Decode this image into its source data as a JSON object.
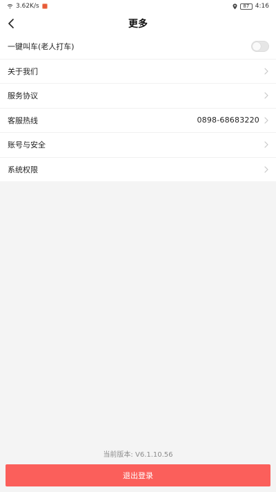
{
  "status_bar": {
    "network_speed": "3.62K/s",
    "time": "4:16",
    "battery": "87"
  },
  "header": {
    "title": "更多"
  },
  "menu": {
    "items": [
      {
        "label": "一键叫车(老人打车)",
        "type": "toggle",
        "enabled": false
      },
      {
        "label": "关于我们",
        "type": "link"
      },
      {
        "label": "服务协议",
        "type": "link"
      },
      {
        "label": "客服热线",
        "type": "link",
        "value": "0898-68683220"
      },
      {
        "label": "账号与安全",
        "type": "link"
      },
      {
        "label": "系统权限",
        "type": "link"
      }
    ]
  },
  "footer": {
    "version_text": "当前版本: V6.1.10.56",
    "logout_label": "退出登录"
  },
  "colors": {
    "accent": "#fb5f5b",
    "background": "#f4f4f4"
  },
  "icons": {
    "back": "chevron-left-icon",
    "row_arrow": "chevron-right-icon",
    "location": "location-icon",
    "battery": "battery-icon",
    "wifi": "wifi-icon"
  }
}
